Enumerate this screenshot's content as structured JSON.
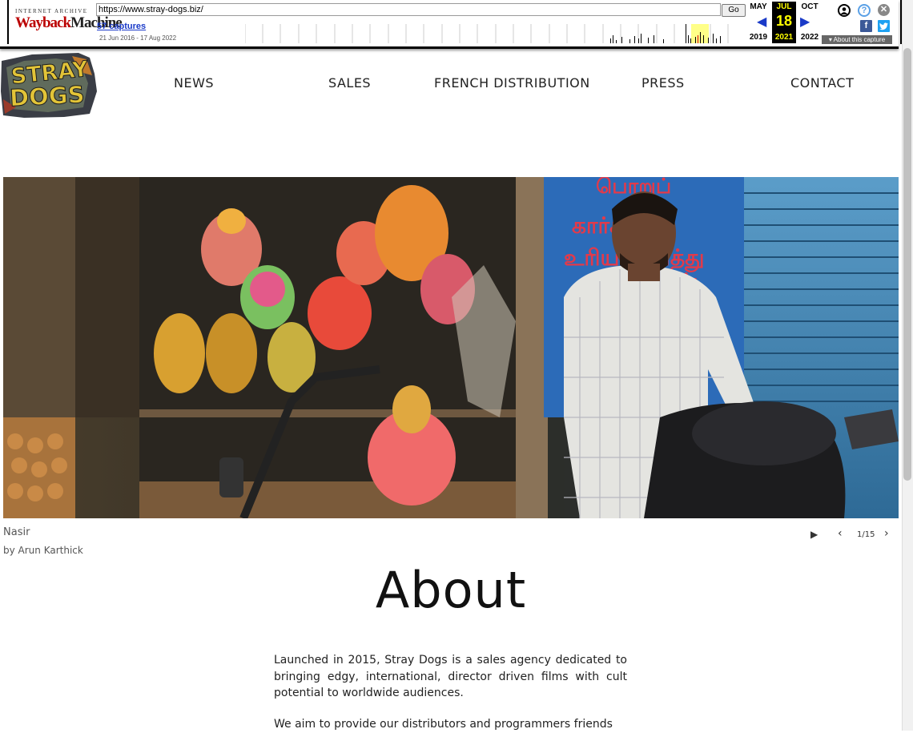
{
  "wayback": {
    "logo_top": "INTERNET ARCHIVE",
    "logo_main_a": "Wayback",
    "logo_main_b": "Machine",
    "url": "https://www.stray-dogs.biz/",
    "go_label": "Go",
    "captures": "57 captures",
    "range": "21 Jun 2016 - 17 Aug 2022",
    "prev_month": "MAY",
    "cur_month": "JUL",
    "next_month": "OCT",
    "day": "18",
    "prev_year": "2019",
    "cur_year": "2021",
    "next_year": "2022",
    "about_capture": "About this capture",
    "help_icon": "?",
    "facebook_icon": "f"
  },
  "site": {
    "logo_line1": "STRAY",
    "logo_line2": "DOGS",
    "nav": [
      "NEWS",
      "SALES",
      "FRENCH DISTRIBUTION",
      "PRESS",
      "CONTACT"
    ]
  },
  "slideshow": {
    "title": "Nasir",
    "byline": "by Arun Karthick",
    "counter": "1/15",
    "signage_lines": [
      "பொறுப்",
      "கார்க்கு",
      "உரிய னைத்து",
      "ள்"
    ]
  },
  "about": {
    "heading": "About",
    "paragraphs": [
      "Launched in 2015, Stray Dogs is a sales agency dedicated to bringing edgy, international, director driven films with cult potential to worldwide audiences.",
      "We aim to provide our distributors and programmers friends"
    ]
  }
}
